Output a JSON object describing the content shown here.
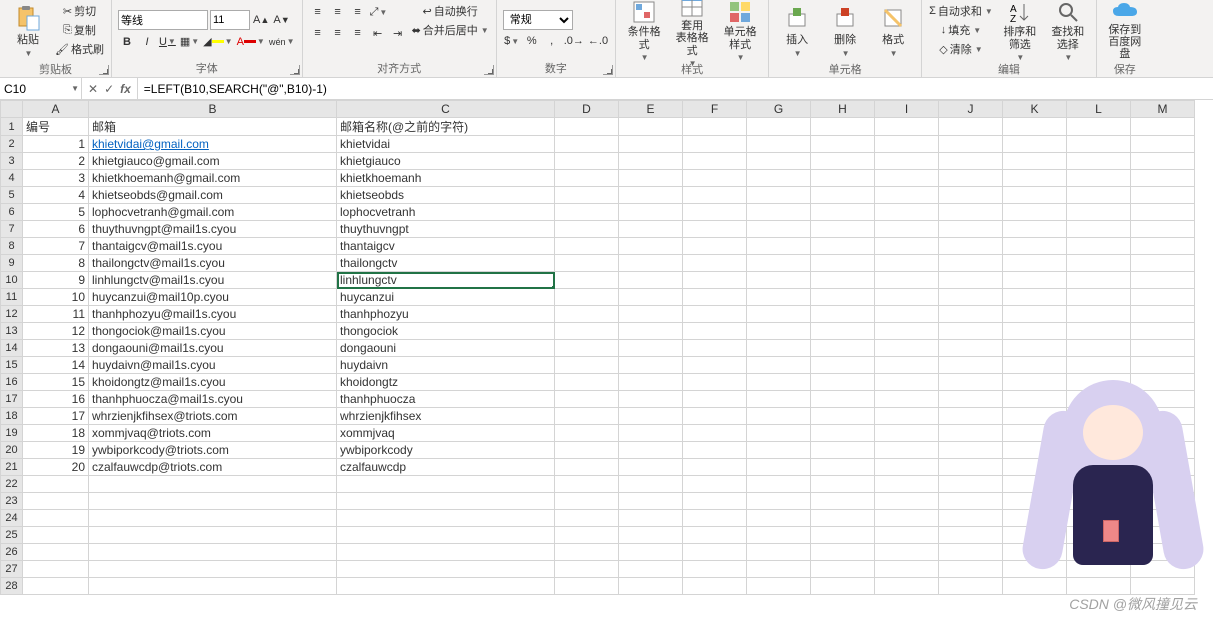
{
  "ribbon": {
    "clipboard": {
      "paste": "粘贴",
      "cut": "剪切",
      "copy": "复制",
      "format_painter": "格式刷",
      "label": "剪贴板"
    },
    "font": {
      "name": "等线",
      "size": "11",
      "label": "字体"
    },
    "align": {
      "wrap": "自动换行",
      "merge": "合并后居中",
      "label": "对齐方式"
    },
    "number": {
      "format": "常规",
      "label": "数字"
    },
    "styles": {
      "cond": "条件格式",
      "table": "套用\n表格格式",
      "cell": "单元格样式",
      "label": "样式"
    },
    "cells": {
      "insert": "插入",
      "delete": "删除",
      "format": "格式",
      "label": "单元格"
    },
    "editing": {
      "autosum": "自动求和",
      "fill": "填充",
      "clear": "清除",
      "sort": "排序和筛选",
      "find": "查找和选择",
      "label": "编辑"
    },
    "save": {
      "btn": "保存到\n百度网盘",
      "label": "保存"
    }
  },
  "namebox": "C10",
  "formula": "=LEFT(B10,SEARCH(\"@\",B10)-1)",
  "columns": [
    "A",
    "B",
    "C",
    "D",
    "E",
    "F",
    "G",
    "H",
    "I",
    "J",
    "K",
    "L",
    "M"
  ],
  "headers": {
    "A": "编号",
    "B": "邮箱",
    "C": "邮箱名称(@之前的字符)"
  },
  "rows": [
    {
      "n": 1,
      "email": "khietvidai@gmail.com",
      "name": "khietvidai",
      "link": true
    },
    {
      "n": 2,
      "email": "khietgiauco@gmail.com",
      "name": "khietgiauco"
    },
    {
      "n": 3,
      "email": "khietkhoemanh@gmail.com",
      "name": "khietkhoemanh"
    },
    {
      "n": 4,
      "email": "khietseobds@gmail.com",
      "name": "khietseobds"
    },
    {
      "n": 5,
      "email": "lophocvetranh@gmail.com",
      "name": "lophocvetranh"
    },
    {
      "n": 6,
      "email": "thuythuvngpt@mail1s.cyou",
      "name": "thuythuvngpt"
    },
    {
      "n": 7,
      "email": "thantaigcv@mail1s.cyou",
      "name": "thantaigcv"
    },
    {
      "n": 8,
      "email": "thailongctv@mail1s.cyou",
      "name": "thailongctv"
    },
    {
      "n": 9,
      "email": "linhlungctv@mail1s.cyou",
      "name": "linhlungctv"
    },
    {
      "n": 10,
      "email": "huycanzui@mail10p.cyou",
      "name": "huycanzui"
    },
    {
      "n": 11,
      "email": "thanhphozyu@mail1s.cyou",
      "name": "thanhphozyu"
    },
    {
      "n": 12,
      "email": "thongociok@mail1s.cyou",
      "name": "thongociok"
    },
    {
      "n": 13,
      "email": "dongaouni@mail1s.cyou",
      "name": "dongaouni"
    },
    {
      "n": 14,
      "email": "huydaivn@mail1s.cyou",
      "name": "huydaivn"
    },
    {
      "n": 15,
      "email": "khoidongtz@mail1s.cyou",
      "name": "khoidongtz"
    },
    {
      "n": 16,
      "email": "thanhphuocza@mail1s.cyou",
      "name": "thanhphuocza"
    },
    {
      "n": 17,
      "email": "whrzienjkfihsex@triots.com",
      "name": "whrzienjkfihsex"
    },
    {
      "n": 18,
      "email": "xommjvaq@triots.com",
      "name": "xommjvaq"
    },
    {
      "n": 19,
      "email": "ywbiporkcody@triots.com",
      "name": "ywbiporkcody"
    },
    {
      "n": 20,
      "email": "czalfauwcdp@triots.com",
      "name": "czalfauwcdp"
    }
  ],
  "blank_rows": [
    22,
    23,
    24,
    25,
    26,
    27,
    28
  ],
  "selected": "C10",
  "watermark": "CSDN @微风撞见云"
}
